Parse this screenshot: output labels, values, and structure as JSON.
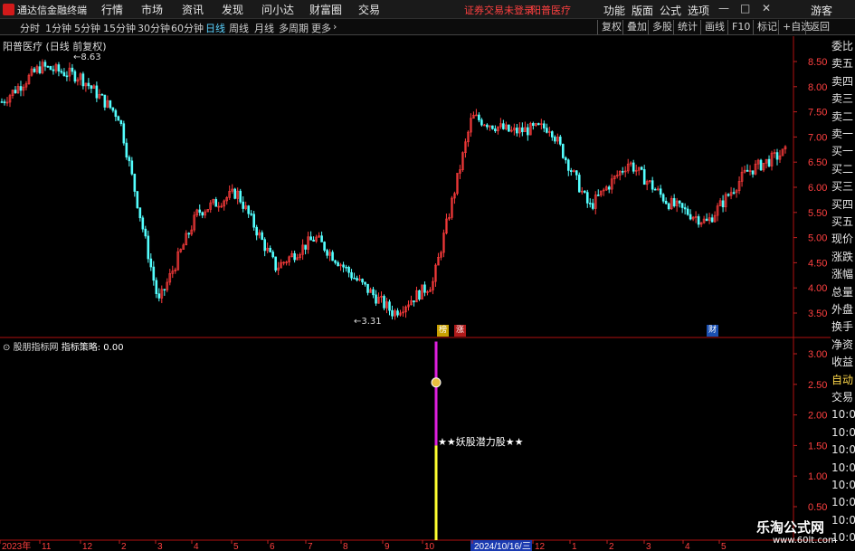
{
  "app": {
    "title": "通达信金融终端"
  },
  "menu": [
    "行情",
    "市场",
    "资讯",
    "发现",
    "问小达",
    "财富圈",
    "交易"
  ],
  "notice": {
    "warning": "证券交易未登录",
    "stock": "阳普医疗"
  },
  "menu_right": [
    "功能",
    "版面",
    "公式",
    "选项",
    "游客"
  ],
  "window_buttons": {
    "min": "—",
    "restore": "□",
    "close": "✕"
  },
  "periods": [
    "分时",
    "1分钟",
    "5分钟",
    "15分钟",
    "30分钟",
    "60分钟",
    "日线",
    "周线",
    "月线",
    "多周期",
    "更多"
  ],
  "active_period": "日线",
  "toolbar": [
    "复权",
    "叠加",
    "多股",
    "统计",
    "画线",
    "F10",
    "标记",
    "+自选",
    "返回"
  ],
  "main_title": "阳普医疗 (日线 前复权)",
  "indicator_title": "股朋指标网",
  "indicator_value": "指标策略: 0.00",
  "signal_label": "★★妖股潜力股★★",
  "money_icon": "money-bag-icon",
  "extremes": {
    "high": "8.63",
    "low": "3.31",
    "high_arrow": "←",
    "low_arrow": "←"
  },
  "event_flags": [
    {
      "label": "榜",
      "color": "#c8a000"
    },
    {
      "label": "涨",
      "color": "#b01a1a"
    },
    {
      "label": "财",
      "color": "#1a4fb0"
    }
  ],
  "price_axis": [
    "8.50",
    "8.00",
    "7.50",
    "7.00",
    "6.50",
    "6.00",
    "5.50",
    "5.00",
    "4.50",
    "4.00",
    "3.50"
  ],
  "indicator_axis": [
    "3.00",
    "2.50",
    "2.00",
    "1.50",
    "1.00",
    "0.50"
  ],
  "date_axis": [
    "2023年",
    "11",
    "12",
    "2",
    "3",
    "4",
    "5",
    "6",
    "7",
    "8",
    "9",
    "10",
    "2024/10/16/三",
    "12",
    "1",
    "2",
    "3",
    "4",
    "5"
  ],
  "side_panel": [
    "委比",
    "卖五",
    "卖四",
    "卖三",
    "卖二",
    "卖一",
    "买一",
    "买二",
    "买三",
    "买四",
    "买五",
    "现价",
    "涨跌",
    "涨幅",
    "总量",
    "外盘",
    "换手",
    "净资",
    "收益",
    "自动",
    "交易",
    "10:04",
    "10:04",
    "10:04",
    "10:04",
    "10:04",
    "10:04",
    "10:05",
    "10:05"
  ],
  "watermark": {
    "name": "乐淘公式网",
    "url": "www.60lt.com"
  },
  "colors": {
    "up": "#ff3c3c",
    "down": "#54ffff",
    "axis": "#ff3030",
    "signal_top": "#e020e0",
    "signal_bottom": "#ffff30"
  },
  "chart_data": [
    {
      "type": "candlestick",
      "title": "阳普医疗 (日线 前复权)",
      "x": [
        "2023-10",
        "2023-11",
        "2023-12",
        "2024-01",
        "2024-02",
        "2024-03",
        "2024-04",
        "2024-05",
        "2024-06",
        "2024-07",
        "2024-08",
        "2024-09",
        "2024-10",
        "2024-11",
        "2024-12",
        "2025-01",
        "2025-02",
        "2025-03",
        "2025-04",
        "2025-05"
      ],
      "close": [
        7.7,
        8.4,
        8.2,
        7.4,
        3.7,
        5.5,
        5.9,
        4.4,
        5.0,
        4.2,
        3.5,
        4.1,
        7.4,
        7.1,
        7.2,
        5.6,
        6.5,
        5.7,
        5.3,
        6.3,
        6.7
      ],
      "ylim": [
        3.2,
        8.7
      ],
      "high": 8.63,
      "low": 3.31
    },
    {
      "type": "bar",
      "title": "股朋指标网",
      "signal_date": "2024-10-16",
      "signal_value": 3.0,
      "ylim": [
        0.25,
        3.2
      ]
    }
  ]
}
